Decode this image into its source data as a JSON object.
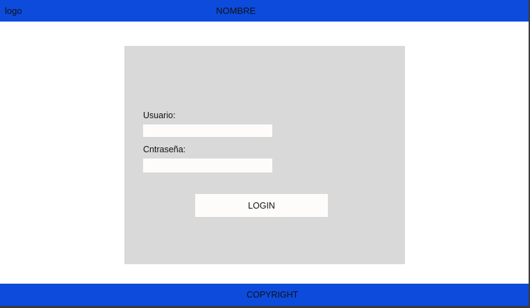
{
  "header": {
    "logo_text": "logo",
    "app_name": "NOMBRE"
  },
  "login_form": {
    "username_label": "Usuario:",
    "username_value": "",
    "password_label": "Cntraseña:",
    "password_value": "",
    "login_button_label": "LOGIN"
  },
  "footer": {
    "copyright_text": "COPYRIGHT"
  },
  "colors": {
    "header_footer_bg": "#0c4bdc",
    "panel_bg": "#d9d9d9",
    "input_bg": "#fefbfb",
    "page_bg": "#ffffff"
  }
}
